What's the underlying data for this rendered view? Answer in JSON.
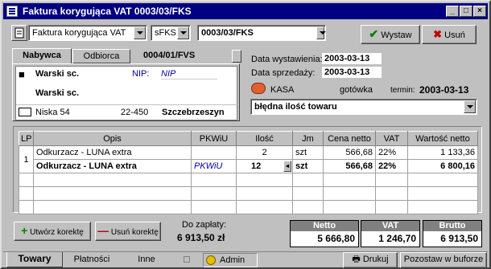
{
  "window": {
    "title": "Faktura korygująca VAT 0003/03/FKS"
  },
  "toolbar": {
    "doc_type": "Faktura korygująca VAT",
    "series": "sFKS",
    "doc_number": "0003/03/FKS",
    "issue_label": "Wystaw",
    "cancel_label": "Usuń"
  },
  "party": {
    "tab_buyer": "Nabywca",
    "tab_receiver": "Odbiorca",
    "invoice_ref": "0004/01/FVS",
    "name1": "Warski sc.",
    "nip_label": "NIP:",
    "nip_value": "NIP",
    "name2": "Warski sc.",
    "street": "Niska 54",
    "zip": "22-450",
    "city": "Szczebrzeszyn"
  },
  "dates": {
    "issue_label": "Data wystawienia:",
    "issue_value": "2003-03-13",
    "sale_label": "Data sprzedaży:",
    "sale_value": "2003-03-13"
  },
  "payment": {
    "form": "KASA",
    "method": "gotówka",
    "due_label": "termin:",
    "due_value": "2003-03-13",
    "reason": "błędna ilość towaru"
  },
  "table": {
    "headers": [
      "LP",
      "Opis",
      "PKWiU",
      "Ilość",
      "Jm",
      "Cena netto",
      "VAT",
      "Wartość netto"
    ],
    "rows": [
      {
        "lp": "1",
        "opis": "Odkurzacz - LUNA extra",
        "pkwiu": "",
        "ilosc": "2",
        "jm": "szt",
        "cena": "566,68",
        "vat": "22%",
        "wartosc": "1 133,36"
      },
      {
        "lp": "",
        "opis": "Odkurzacz - LUNA extra",
        "pkwiu": "PKWiU",
        "ilosc": "12",
        "jm": "szt",
        "cena": "566,68",
        "vat": "22%",
        "wartosc": "6 800,16"
      }
    ]
  },
  "bottom": {
    "create_correction": "Utwórz korektę",
    "delete_correction": "Usuń korektę",
    "to_pay_label": "Do zapłaty:",
    "to_pay_value": "6 913,50 zł",
    "netto_label": "Netto",
    "netto_value": "5 666,80",
    "vat_label": "VAT",
    "vat_value": "1 246,70",
    "brutto_label": "Brutto",
    "brutto_value": "6 913,50"
  },
  "statusbar": {
    "tab_goods": "Towary",
    "tab_payments": "Płatności",
    "tab_other": "Inne",
    "user": "Admin",
    "print_label": "Drukuj",
    "buffer_label": "Pozostaw w buforze"
  },
  "colors": {
    "title_bg": "#000080",
    "window_bg": "#c0c0c0",
    "issue_check": "#008000",
    "cancel_x": "#c00000"
  }
}
